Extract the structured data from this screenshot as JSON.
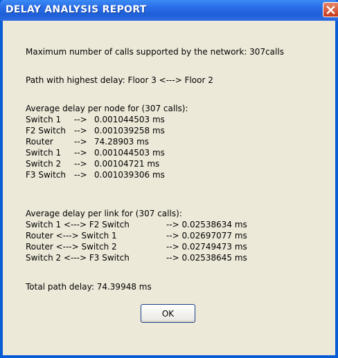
{
  "window": {
    "title": "DELAY ANALYSIS REPORT",
    "close_icon": "close-icon"
  },
  "report": {
    "max_calls": "Maximum number of calls supported by the network: 307calls",
    "highest_delay_path": "Path with highest delay: Floor 3 <---> Floor 2",
    "node_heading": "Average delay per node for (307 calls):",
    "nodes": [
      {
        "name": "Switch 1",
        "sep": "-->",
        "value": "0.001044503 ms"
      },
      {
        "name": "F2 Switch",
        "sep": "-->",
        "value": "0.001039258 ms"
      },
      {
        "name": "Router",
        "sep": "-->",
        "value": "74.28903 ms"
      },
      {
        "name": "Switch 1",
        "sep": "-->",
        "value": "0.001044503 ms"
      },
      {
        "name": "Switch 2",
        "sep": "-->",
        "value": "0.00104721 ms"
      },
      {
        "name": "F3 Switch",
        "sep": "-->",
        "value": "0.001039306 ms"
      }
    ],
    "link_heading": "Average delay per link for (307 calls):",
    "links": [
      {
        "name": "Switch 1 <---> F2 Switch",
        "value": "--> 0.02538634 ms"
      },
      {
        "name": "Router <---> Switch 1",
        "value": "--> 0.02697077 ms"
      },
      {
        "name": "Router <---> Switch 2",
        "value": "--> 0.02749473 ms"
      },
      {
        "name": "Switch 2 <---> F3 Switch",
        "value": "--> 0.02538645 ms"
      }
    ],
    "total": "Total path delay: 74.39948 ms"
  },
  "buttons": {
    "ok_label": "OK"
  },
  "colors": {
    "titlebar": "#2a6ee8",
    "window_bg": "#ece9d8",
    "close_button": "#c5391a"
  }
}
